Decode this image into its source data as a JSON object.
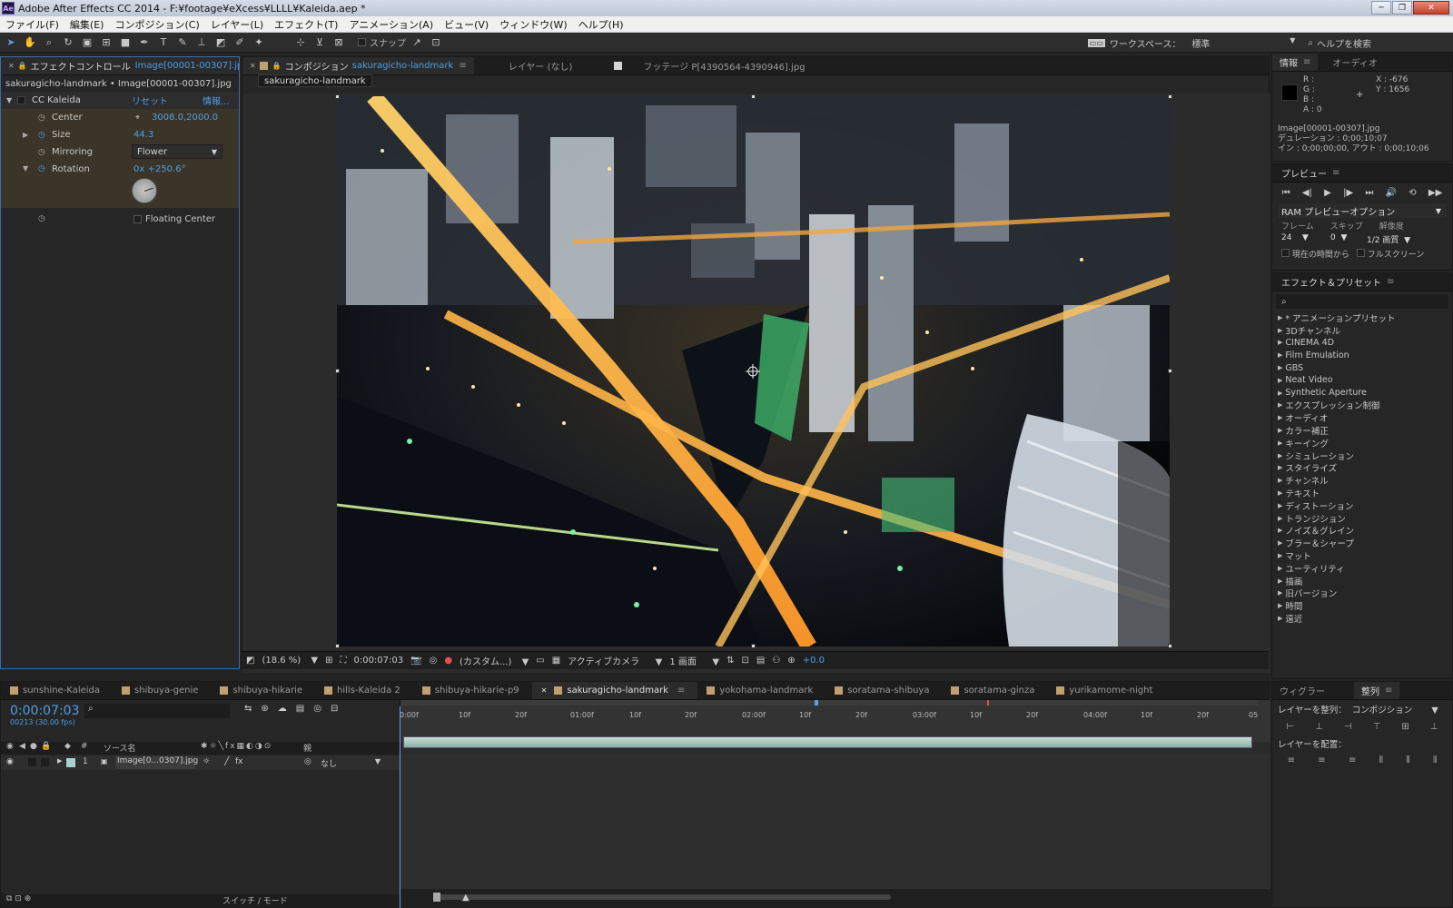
{
  "window": {
    "title": "Adobe After Effects CC 2014 - F:¥footage¥eXcess¥LLLL¥Kaleida.aep *",
    "app_badge": "Ae"
  },
  "menu": [
    "ファイル(F)",
    "編集(E)",
    "コンポジション(C)",
    "レイヤー(L)",
    "エフェクト(T)",
    "アニメーション(A)",
    "ビュー(V)",
    "ウィンドウ(W)",
    "ヘルプ(H)"
  ],
  "toolbar": {
    "snap_label": "スナップ",
    "workspace_label": "ワークスペース：",
    "workspace_value": "標準",
    "help_placeholder": "ヘルプを検索"
  },
  "effect_controls": {
    "tab_label": "エフェクトコントロール",
    "tab_layer": "Image[00001-00307].jpg",
    "subtitle": "sakuragicho-landmark • Image[00001-00307].jpg",
    "effect_name": "CC Kaleida",
    "reset": "リセット",
    "about": "情報...",
    "params": {
      "center_label": "Center",
      "center_value": "3008.0,2000.0",
      "size_label": "Size",
      "size_value": "44.3",
      "mirroring_label": "Mirroring",
      "mirroring_value": "Flower",
      "rotation_label": "Rotation",
      "rotation_value": "0x +250.6°",
      "floating_label": "Floating Center"
    }
  },
  "comp_panel": {
    "tab_prefix": "コンポジション",
    "tab_comp": "sakuragicho-landmark",
    "layer_tab": "レイヤー (なし)",
    "footage_tab": "フッテージ P[4390564-4390946].jpg",
    "flowchart": "sakuragicho-landmark"
  },
  "viewer_footer": {
    "zoom": "(18.6 %)",
    "time": "0:00:07:03",
    "resolution": "(カスタム...)",
    "camera": "アクティブカメラ",
    "views": "1 画面",
    "exposure": "+0.0"
  },
  "info_panel": {
    "tab": "情報",
    "audio_tab": "オーディオ",
    "r": "R :",
    "g": "G :",
    "b": "B :",
    "a": "A : 0",
    "x": "X : -676",
    "y": "Y : 1656",
    "file": "Image[00001-00307].jpg",
    "duration": "デュレーション : 0;00;10;07",
    "inout": "イン : 0;00;00;00, アウト : 0;00;10;06"
  },
  "preview_panel": {
    "tab": "プレビュー",
    "ram": "RAM プレビューオプション",
    "frame_label": "フレーム",
    "skip_label": "スキップ",
    "res_label": "解像度",
    "frame": "24",
    "skip": "0",
    "res": "1/2 画質",
    "from_current": "現在の時間から",
    "fullscreen": "フルスクリーン"
  },
  "effects_presets": {
    "tab": "エフェクト＆プリセット",
    "search_placeholder": "",
    "items": [
      "* アニメーションプリセット",
      "3Dチャンネル",
      "CINEMA 4D",
      "Film Emulation",
      "GBS",
      "Neat Video",
      "Synthetic Aperture",
      "エクスプレッション制御",
      "オーディオ",
      "カラー補正",
      "キーイング",
      "シミュレーション",
      "スタイライズ",
      "チャンネル",
      "テキスト",
      "ディストーション",
      "トランジション",
      "ノイズ＆グレイン",
      "ブラー＆シャープ",
      "マット",
      "ユーティリティ",
      "描画",
      "旧バージョン",
      "時間",
      "遠近"
    ]
  },
  "align_panel": {
    "wiggler_tab": "ウィグラー",
    "align_tab": "整列",
    "align_to_label": "レイヤーを整列：",
    "align_to_value": "コンポジション",
    "distribute_label": "レイヤーを配置："
  },
  "timeline": {
    "tabs": [
      "sunshine-Kaleida",
      "shibuya-genie",
      "shibuya-hikarie",
      "hills-Kaleida 2",
      "shibuya-hikarie-p9",
      "sakuragicho-landmark",
      "yokohama-landmark",
      "soratama-shibuya",
      "soratama-ginza",
      "yurikamome-night"
    ],
    "active_tab": "sakuragicho-landmark",
    "timecode": "0:00:07:03",
    "frame_info": "00213 (30.00 fps)",
    "source_header": "ソース名",
    "parent_header": "親",
    "layer": {
      "num": "1",
      "name": "Image[0...0307].jpg",
      "parent": "なし"
    },
    "ruler_labels": [
      [
        "0:00f",
        0
      ],
      [
        "10f",
        65
      ],
      [
        "20f",
        127
      ],
      [
        "01:00f",
        188
      ],
      [
        "10f",
        253
      ],
      [
        "20f",
        314
      ],
      [
        "02:00f",
        377
      ],
      [
        "10f",
        440
      ],
      [
        "20f",
        502
      ],
      [
        "03:00f",
        565
      ],
      [
        "10f",
        628
      ],
      [
        "20f",
        690
      ],
      [
        "04:00f",
        753
      ],
      [
        "10f",
        816
      ],
      [
        "20f",
        878
      ],
      [
        "05",
        935
      ]
    ],
    "switch_mode": "スイッチ / モード"
  }
}
